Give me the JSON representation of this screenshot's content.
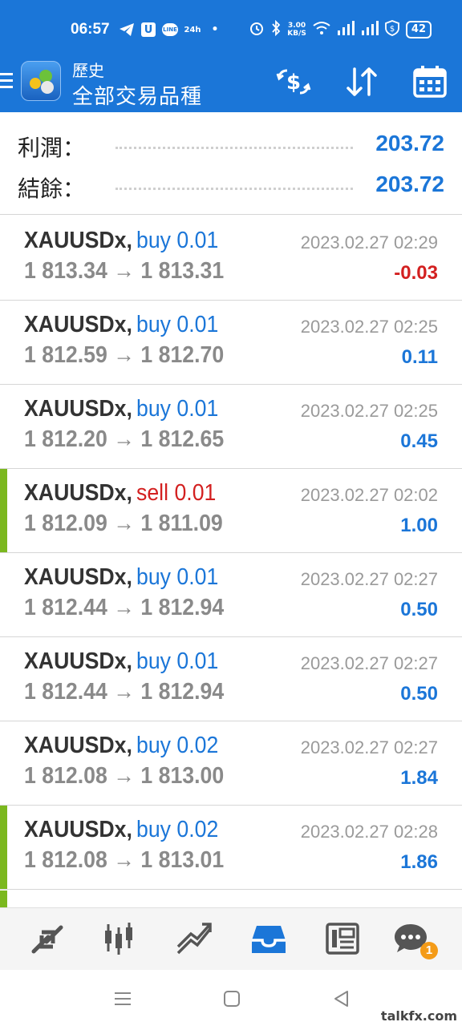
{
  "status_bar": {
    "time": "06:57",
    "speed_value": "3.00",
    "speed_unit": "KB/S",
    "battery": "42",
    "left_icons": [
      "telegram-icon",
      "u-icon",
      "line-icon",
      "24h-icon",
      "dot-icon"
    ],
    "right_icons": [
      "alarm-icon",
      "bluetooth-icon",
      "wifi-icon",
      "signal-icon",
      "signal-icon",
      "shield-dollar-icon",
      "battery-icon"
    ]
  },
  "app_bar": {
    "subtitle": "歷史",
    "title": "全部交易品種",
    "actions": [
      "deposit-withdraw-icon",
      "sort-icon",
      "calendar-icon"
    ]
  },
  "summary": {
    "profit_label": "利潤：",
    "profit_value": "203.72",
    "balance_label": "結餘：",
    "balance_value": "203.72"
  },
  "trades": [
    {
      "symbol": "XAUUSDx,",
      "side": "buy 0.01",
      "type": "buy",
      "time": "2023.02.27 02:29",
      "prices": "1 813.34 → 1 813.31",
      "profit": "-0.03",
      "sign": "neg",
      "marked": false
    },
    {
      "symbol": "XAUUSDx,",
      "side": "buy 0.01",
      "type": "buy",
      "time": "2023.02.27 02:25",
      "prices": "1 812.59 → 1 812.70",
      "profit": "0.11",
      "sign": "pos",
      "marked": false
    },
    {
      "symbol": "XAUUSDx,",
      "side": "buy 0.01",
      "type": "buy",
      "time": "2023.02.27 02:25",
      "prices": "1 812.20 → 1 812.65",
      "profit": "0.45",
      "sign": "pos",
      "marked": false
    },
    {
      "symbol": "XAUUSDx,",
      "side": "sell 0.01",
      "type": "sell",
      "time": "2023.02.27 02:02",
      "prices": "1 812.09 → 1 811.09",
      "profit": "1.00",
      "sign": "pos",
      "marked": true
    },
    {
      "symbol": "XAUUSDx,",
      "side": "buy 0.01",
      "type": "buy",
      "time": "2023.02.27 02:27",
      "prices": "1 812.44 → 1 812.94",
      "profit": "0.50",
      "sign": "pos",
      "marked": false
    },
    {
      "symbol": "XAUUSDx,",
      "side": "buy 0.01",
      "type": "buy",
      "time": "2023.02.27 02:27",
      "prices": "1 812.44 → 1 812.94",
      "profit": "0.50",
      "sign": "pos",
      "marked": false
    },
    {
      "symbol": "XAUUSDx,",
      "side": "buy 0.02",
      "type": "buy",
      "time": "2023.02.27 02:27",
      "prices": "1 812.08 → 1 813.00",
      "profit": "1.84",
      "sign": "pos",
      "marked": false
    },
    {
      "symbol": "XAUUSDx,",
      "side": "buy 0.02",
      "type": "buy",
      "time": "2023.02.27 02:28",
      "prices": "1 812.08 → 1 813.01",
      "profit": "1.86",
      "sign": "pos",
      "marked": true
    }
  ],
  "bottom_nav": {
    "items": [
      "quotes-icon",
      "chart-icon",
      "trade-icon",
      "history-icon",
      "news-icon",
      "chat-icon"
    ],
    "active": "history-icon",
    "chat_badge": "1"
  },
  "system_nav": [
    "menu-icon",
    "home-icon",
    "back-icon"
  ],
  "watermark": "talkfx.com",
  "colors": {
    "primary": "#1b76d8",
    "sell": "#d32020",
    "marker": "#7bb81f",
    "badge": "#f49b18"
  }
}
